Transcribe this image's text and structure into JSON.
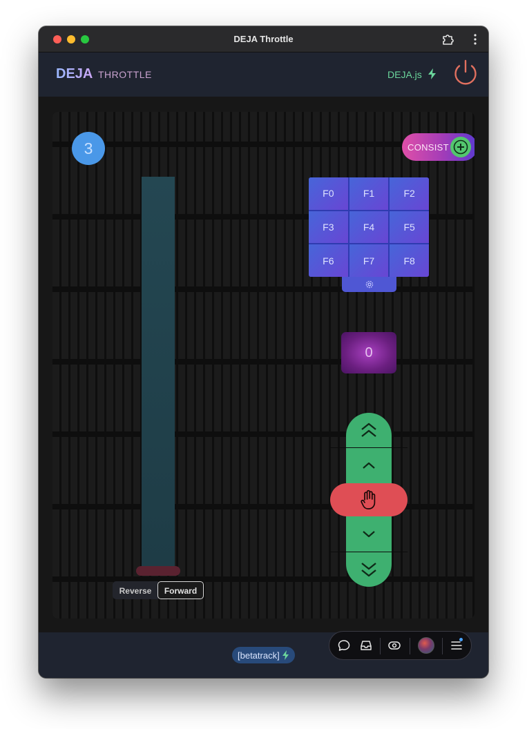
{
  "window": {
    "title": "DEJA Throttle"
  },
  "header": {
    "brand_primary": "DEJA",
    "brand_secondary": "THROTTLE",
    "status_label": "DEJA.js"
  },
  "throttle": {
    "loco_number": "3",
    "consist_label": "CONSIST",
    "speed": "0",
    "direction": {
      "reverse_label": "Reverse",
      "forward_label": "Forward",
      "selected": "Forward"
    },
    "functions": [
      "F0",
      "F1",
      "F2",
      "F3",
      "F4",
      "F5",
      "F6",
      "F7",
      "F8"
    ]
  },
  "footer": {
    "layout_badge": "[betatrack]"
  },
  "colors": {
    "loco_badge": "#4a98e8",
    "speed_pad": "#3eb070",
    "stop": "#df4e55",
    "function_grid": "#5257d6",
    "status_ok": "#6bd69c",
    "power": "#e0705f"
  },
  "icons": {
    "extensions": "puzzle-piece-icon",
    "menu": "kebab-menu-icon",
    "status": "bolt-icon",
    "power": "power-icon",
    "consist_add": "plus-icon",
    "function_settings": "gear-icon",
    "speed_up_fast": "double-chevron-up-icon",
    "speed_up": "chevron-up-icon",
    "stop": "hand-icon",
    "speed_down": "chevron-down-icon",
    "speed_down_fast": "double-chevron-down-icon",
    "toolbar": [
      "chat-icon",
      "inbox-icon",
      "eye-icon",
      "avatar",
      "menu-icon"
    ]
  }
}
